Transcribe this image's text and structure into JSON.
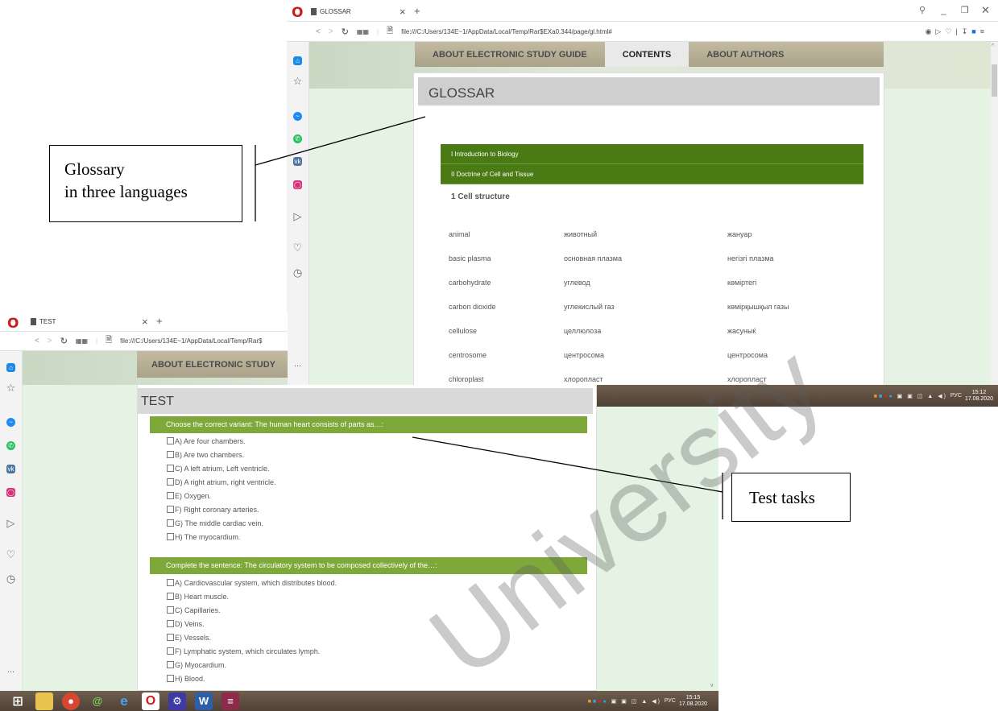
{
  "glossar_window": {
    "tab_title": "GLOSSAR",
    "address": "file:///C:/Users/134E~1/AppData/Local/Temp/Rar$EXa0.344/page/gl.html#",
    "nav": [
      "ABOUT ELECTRONIC STUDY GUIDE",
      "CONTENTS",
      "ABOUT AUTHORS"
    ],
    "heading": "GLOSSAR",
    "sections": [
      "I Introduction to Biology",
      "II Doctrine of Cell and Tissue"
    ],
    "subheading": "1 Cell structure",
    "terms": [
      {
        "en": "animal",
        "ru": "животный",
        "kz": "жануар"
      },
      {
        "en": "basic plasma",
        "ru": "основная плазма",
        "kz": "негізгі плазма"
      },
      {
        "en": "carbohydrate",
        "ru": "углевод",
        "kz": "көміртегі"
      },
      {
        "en": "carbon dioxide",
        "ru": "углекислый газ",
        "kz": "көмірқышқыл газы"
      },
      {
        "en": "cellulose",
        "ru": "целлюлоза",
        "kz": "жасуныќ"
      },
      {
        "en": "centrosome",
        "ru": "центросома",
        "kz": "центросома"
      },
      {
        "en": "chloroplast",
        "ru": "хлоропласт",
        "kz": "хлоропласт"
      }
    ],
    "clock_time": "15:12",
    "clock_date": "17.08.2020",
    "lang": "РУС"
  },
  "test_window": {
    "tab_title": "TEST",
    "address": "file:///C:/Users/134E~1/AppData/Local/Temp/Rar$",
    "nav": "ABOUT ELECTRONIC STUDY",
    "heading": "TEST",
    "questions": [
      {
        "text": "Choose the correct variant: The human heart consists of parts as…:",
        "options": [
          "A) Are four chambers.",
          "B) Are two chambers.",
          "C) A left atrium, Left ventricle.",
          "D) A right atrium, right ventricle.",
          "E) Oxygen.",
          "F) Right coronary arteries.",
          "G) The middle cardiac vein.",
          "H) The myocardium."
        ]
      },
      {
        "text": "Complete the sentence: The circulatory system to be composed collectively of the…:",
        "options": [
          "A) Cardiovascular system, which distributes blood.",
          "B) Heart muscle.",
          "C) Capillaries.",
          "D) Veins.",
          "E) Vessels.",
          "F) Lymphatic system, which circulates lymph.",
          "G) Myocardium.",
          "H) Blood."
        ]
      }
    ],
    "clock_time": "15:15",
    "clock_date": "17.08.2020",
    "lang": "РУС"
  },
  "annotations": {
    "glossary_line1": "Glossary",
    "glossary_line2": "in three languages",
    "test": "Test tasks"
  },
  "watermark": "University",
  "more_label": "...",
  "tab_close": "×",
  "tab_add": "+",
  "icons": [
    "opera-logo",
    "back-icon",
    "forward-icon",
    "reload-icon",
    "speed-dial-icon",
    "page-icon",
    "search-icon",
    "minimize-icon",
    "restore-icon",
    "close-icon",
    "camera-icon",
    "send-icon",
    "heart-icon",
    "download-icon",
    "battery-icon",
    "menu-icon",
    "home-icon",
    "messenger-icon",
    "whatsapp-icon",
    "vk-icon",
    "instagram-icon",
    "history-icon",
    "windows-start-icon"
  ],
  "colors": {
    "green_dark": "#497a13",
    "green_light": "#7fa83b",
    "page_bg": "#e2f2e2",
    "opera_red": "#d01b1b"
  }
}
